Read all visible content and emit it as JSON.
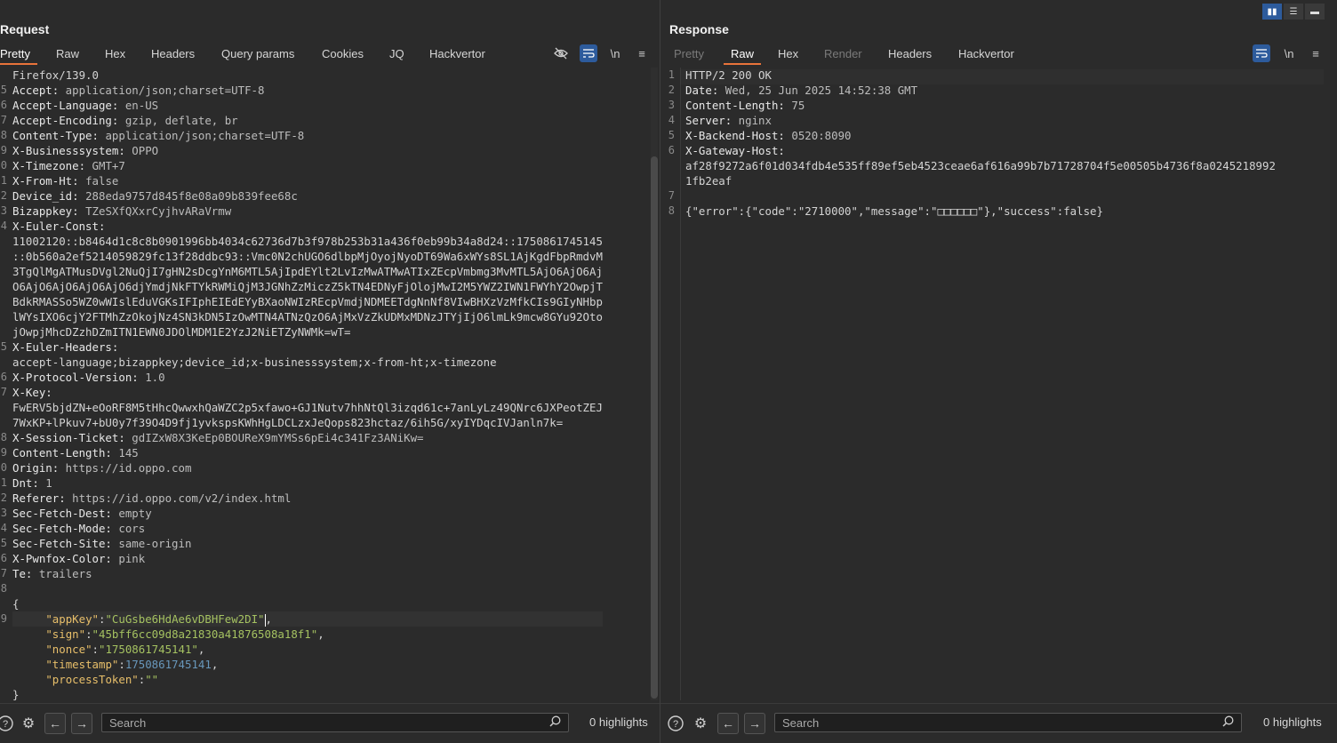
{
  "layout_buttons": [
    {
      "icon": "split-columns-icon",
      "active": true
    },
    {
      "icon": "split-rows-icon",
      "active": false
    },
    {
      "icon": "single-pane-icon",
      "active": false
    }
  ],
  "request": {
    "title": "Request",
    "tabs": [
      "Pretty",
      "Raw",
      "Hex",
      "Headers",
      "Query params",
      "Cookies",
      "JQ",
      "Hackvertor"
    ],
    "active_tab": "Pretty",
    "tools": {
      "hide_icon": "eye-slash-icon",
      "wrap_icon": "wrap-icon",
      "newline_label": "\\n",
      "menu_icon": "hamburger-icon"
    },
    "line_numbers": [
      "",
      "5",
      "6",
      "7",
      "8",
      "9",
      "0",
      "1",
      "2",
      "3",
      "4",
      "",
      "",
      "",
      "",
      "",
      "",
      "",
      "5",
      "",
      "6",
      "7",
      "",
      "",
      "8",
      "9",
      "0",
      "1",
      "2",
      "3",
      "4",
      "5",
      "6",
      "7",
      "8",
      "",
      "9",
      "",
      "",
      "",
      "",
      "",
      ""
    ],
    "lines": [
      {
        "text": "Firefox/139.0"
      },
      {
        "name": "Accept:",
        "value": " application/json;charset=UTF-8"
      },
      {
        "name": "Accept-Language:",
        "value": " en-US"
      },
      {
        "name": "Accept-Encoding:",
        "value": " gzip, deflate, br"
      },
      {
        "name": "Content-Type:",
        "value": " application/json;charset=UTF-8"
      },
      {
        "name": "X-Businesssystem:",
        "value": " OPPO"
      },
      {
        "name": "X-Timezone:",
        "value": " GMT+7"
      },
      {
        "name": "X-From-Ht:",
        "value": " false"
      },
      {
        "name": "Device_id:",
        "value": " 288eda9757d845f8e08a09b839fee68c"
      },
      {
        "name": "Bizappkey:",
        "value": " TZeSXfQXxrCyjhvARaVrmw"
      },
      {
        "name": "X-Euler-Const:",
        "value": ""
      },
      {
        "text": "11002120::b8464d1c8c8b0901996bb4034c62736d7b3f978b253b31a436f0eb99b34a8d24::1750861745145"
      },
      {
        "text": "::0b560a2ef5214059829fc13f28ddbc93::Vmc0N2chUGO6dlbpMjOyojNyoDT69Wa6xWYs8SL1AjKgdFbpRmdvM"
      },
      {
        "text": "3TgQlMgATMusDVgl2NuQjI7gHN2sDcgYnM6MTL5AjIpdEYlt2LvIzMwATMwATIxZEcpVmbmg3MvMTL5AjO6AjO6Aj"
      },
      {
        "text": "O6AjO6AjO6AjO6AjO6djYmdjNkFTYkRWMiQjM3JGNhZzMiczZ5kTN4EDNyFjOlojMwI2M5YWZ2IWN1FWYhY2OwpjT"
      },
      {
        "text": "BdkRMASSo5WZ0wWIslEduVGKsIFIphEIEdEYyBXaoNWIzREcpVmdjNDMEETdgNnNf8VIwBHXzVzMfkCIs9GIyNHbp"
      },
      {
        "text": "lWYsIXO6cjY2FTMhZzOkojNz4SN3kDN5IzOwMTN4ATNzQzO6AjMxVzZkUDMxMDNzJTYjIjO6lmLk9mcw8GYu92Oto"
      },
      {
        "text": "jOwpjMhcDZzhDZmITN1EWN0JDOlMDM1E2YzJ2NiETZyNWMk=wT="
      },
      {
        "name": "X-Euler-Headers:",
        "value": ""
      },
      {
        "text": "accept-language;bizappkey;device_id;x-businesssystem;x-from-ht;x-timezone"
      },
      {
        "name": "X-Protocol-Version:",
        "value": " 1.0"
      },
      {
        "name": "X-Key:",
        "value": ""
      },
      {
        "text": "FwERV5bjdZN+eOoRF8M5tHhcQwwxhQaWZC2p5xfawo+GJ1Nutv7hhNtQl3izqd61c+7anLyLz49QNrc6JXPeotZEJ"
      },
      {
        "text": "7WxKP+lPkuv7+bU0y7f39O4D9fj1yvkspsKWhHgLDCLzxJeQops823hctaz/6ih5G/xyIYDqcIVJanln7k="
      },
      {
        "name": "X-Session-Ticket:",
        "value": " gdIZxW8X3KeEp0BOUReX9mYMSs6pEi4c341Fz3ANiKw="
      },
      {
        "name": "Content-Length:",
        "value": " 145"
      },
      {
        "name": "Origin:",
        "value": " https://id.oppo.com"
      },
      {
        "name": "Dnt:",
        "value": " 1"
      },
      {
        "name": "Referer:",
        "value": " https://id.oppo.com/v2/index.html"
      },
      {
        "name": "Sec-Fetch-Dest:",
        "value": " empty"
      },
      {
        "name": "Sec-Fetch-Mode:",
        "value": " cors"
      },
      {
        "name": "Sec-Fetch-Site:",
        "value": " same-origin"
      },
      {
        "name": "X-Pwnfox-Color:",
        "value": " pink"
      },
      {
        "name": "Te:",
        "value": " trailers"
      },
      {
        "text": ""
      },
      {
        "text": "{"
      },
      {
        "key": "\"appKey\"",
        "sep": ":",
        "str": "\"CuGsbe6HdAe6vDBHFew2DI\"",
        "tail": ",",
        "cursor": true
      },
      {
        "key": "\"sign\"",
        "sep": ":",
        "str": "\"45bff6cc09d8a21830a41876508a18f1\"",
        "tail": ","
      },
      {
        "key": "\"nonce\"",
        "sep": ":",
        "str": "\"1750861745141\"",
        "tail": ","
      },
      {
        "key": "\"timestamp\"",
        "sep": ":",
        "num": "1750861745141",
        "tail": ","
      },
      {
        "key": "\"processToken\"",
        "sep": ":",
        "str": "\"\"",
        "tail": ""
      },
      {
        "text": "}"
      }
    ],
    "search_placeholder": "Search",
    "highlights": "0 highlights"
  },
  "response": {
    "title": "Response",
    "tabs": [
      "Pretty",
      "Raw",
      "Hex",
      "Render",
      "Headers",
      "Hackvertor"
    ],
    "active_tab": "Raw",
    "disabled_tabs": [
      "Pretty",
      "Render"
    ],
    "tools": {
      "wrap_icon": "wrap-icon",
      "newline_label": "\\n",
      "menu_icon": "hamburger-icon"
    },
    "lines": [
      {
        "n": "1",
        "text": "HTTP/2 200 OK"
      },
      {
        "n": "2",
        "name": "Date:",
        "value": " Wed, 25 Jun 2025 14:52:38 GMT"
      },
      {
        "n": "3",
        "name": "Content-Length:",
        "value": " 75"
      },
      {
        "n": "4",
        "name": "Server:",
        "value": " nginx"
      },
      {
        "n": "5",
        "name": "X-Backend-Host:",
        "value": " 0520:8090"
      },
      {
        "n": "6",
        "name": "X-Gateway-Host:",
        "value": ""
      },
      {
        "n": "",
        "text": "af28f9272a6f01d034fdb4e535ff89ef5eb4523ceae6af616a99b7b71728704f5e00505b4736f8a0245218992"
      },
      {
        "n": "",
        "text": "1fb2eaf"
      },
      {
        "n": "7",
        "text": ""
      },
      {
        "n": "8",
        "text": "{\"error\":{\"code\":\"2710000\",\"message\":\"□□□□□□\"},\"success\":false}"
      }
    ],
    "search_placeholder": "Search",
    "highlights": "0 highlights"
  }
}
